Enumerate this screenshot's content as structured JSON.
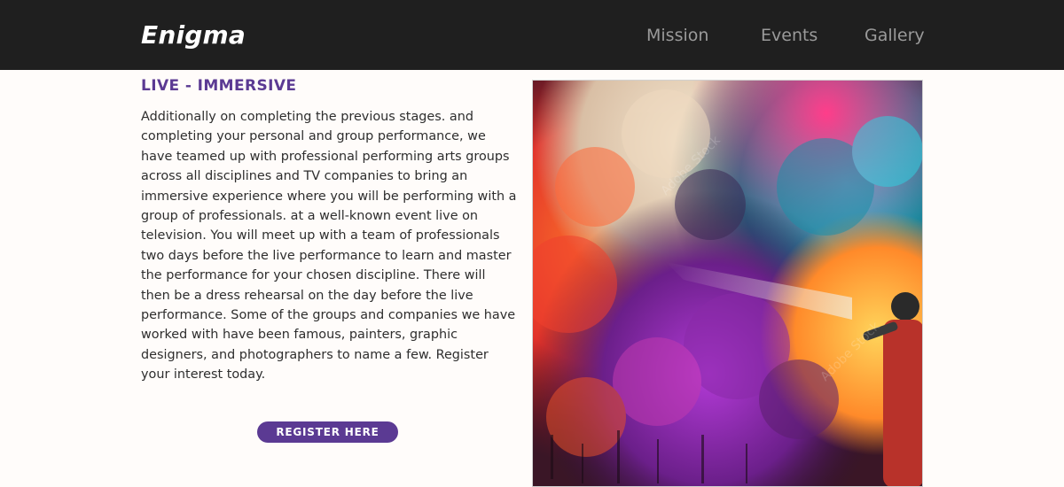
{
  "header": {
    "brand": "Enigma",
    "nav": [
      {
        "label": "Mission"
      },
      {
        "label": "Events"
      },
      {
        "label": "Gallery"
      }
    ]
  },
  "main": {
    "title": "LIVE - IMMERSIVE",
    "paragraph": "Additionally on completing the previous stages. and completing your personal and group performance, we have teamed up with professional performing arts groups across all disciplines and TV companies to bring an immersive experience where you will be performing with a group of professionals. at a well-known event live on television. You will meet up with a team of professionals two days before the live performance to learn and master the performance for your chosen discipline. There will then be a dress rehearsal on the day before the live performance. Some of the groups and companies we have worked with have been famous, painters, graphic designers, and photographers to name a few. Register your interest today.",
    "register_label": "REGISTER HERE"
  },
  "image": {
    "subject": "colorful-paint-cloud-artist-spraying",
    "watermark": "Adobe Stock"
  },
  "colors": {
    "header_bg": "#1f1f1f",
    "accent": "#5b3a93",
    "page_bg": "#fffcfa",
    "nav_text": "#9a9a9a"
  }
}
